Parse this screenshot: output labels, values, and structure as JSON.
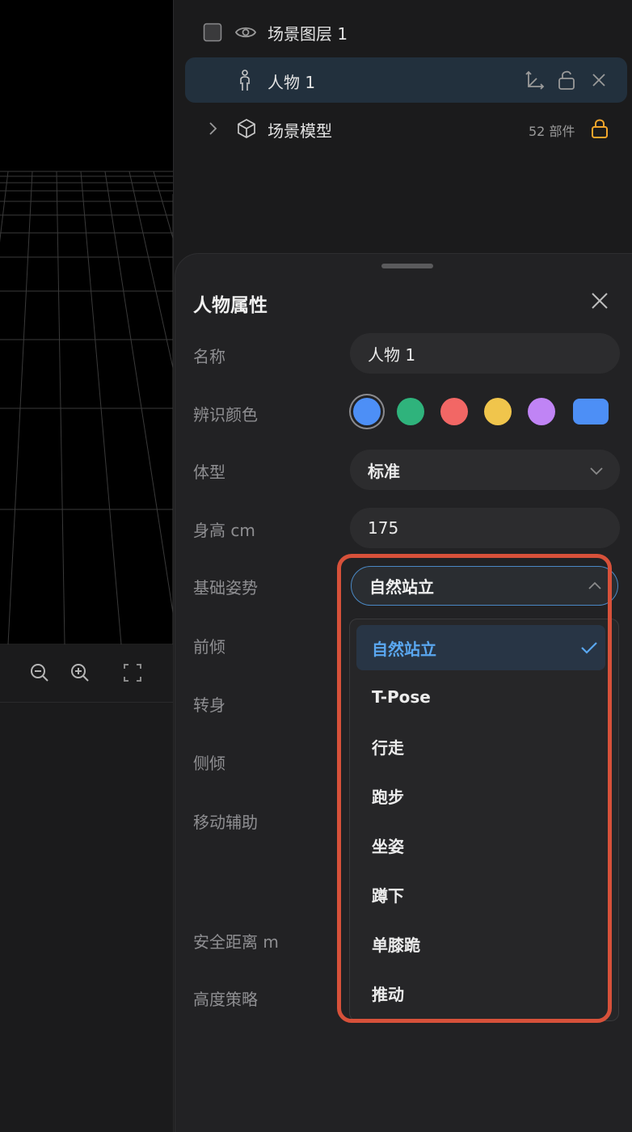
{
  "layers": {
    "group": {
      "label": "场景图层 1",
      "visibility_icon": "eye-icon",
      "checkbox_icon": "checkbox-icon"
    },
    "character": {
      "label": "人物 1",
      "icon": "person-icon",
      "actions": [
        "transform-axes-icon",
        "unlock-icon",
        "close-icon"
      ]
    },
    "model": {
      "label": "场景模型",
      "meta": "52 部件",
      "icon": "cube-icon",
      "lock_icon": "lock-icon",
      "expand_icon": "chevron-right-icon"
    }
  },
  "viewport_toolbar": {
    "buttons": [
      "zoom-out-icon",
      "zoom-in-icon",
      "fullscreen-icon"
    ]
  },
  "properties": {
    "title": "人物属性",
    "close_icon": "close-icon",
    "name_label": "名称",
    "name_value": "人物 1",
    "color_label": "辨识颜色",
    "colors": [
      "#4d8ff6",
      "#2fb37c",
      "#f26765",
      "#f0c54c",
      "#c084f5",
      "#4d8ff6"
    ],
    "selected_color_index": 0,
    "body_label": "体型",
    "body_value": "标准",
    "height_label": "身高 cm",
    "height_value": "175",
    "pose_label": "基础姿势",
    "pose_value": "自然站立",
    "lean_label": "前倾",
    "turn_label": "转身",
    "tilt_label": "侧倾",
    "move_label": "移动辅助",
    "safety_label": "安全距离 m",
    "height_strategy_label": "高度策略"
  },
  "pose_menu": {
    "items": [
      "自然站立",
      "T-Pose",
      "行走",
      "跑步",
      "坐姿",
      "蹲下",
      "单膝跪",
      "推动"
    ],
    "selected_index": 0
  },
  "colors": {
    "accent": "#5aa7f0",
    "highlight_border": "#d7513a",
    "lock": "#f2a52b"
  }
}
